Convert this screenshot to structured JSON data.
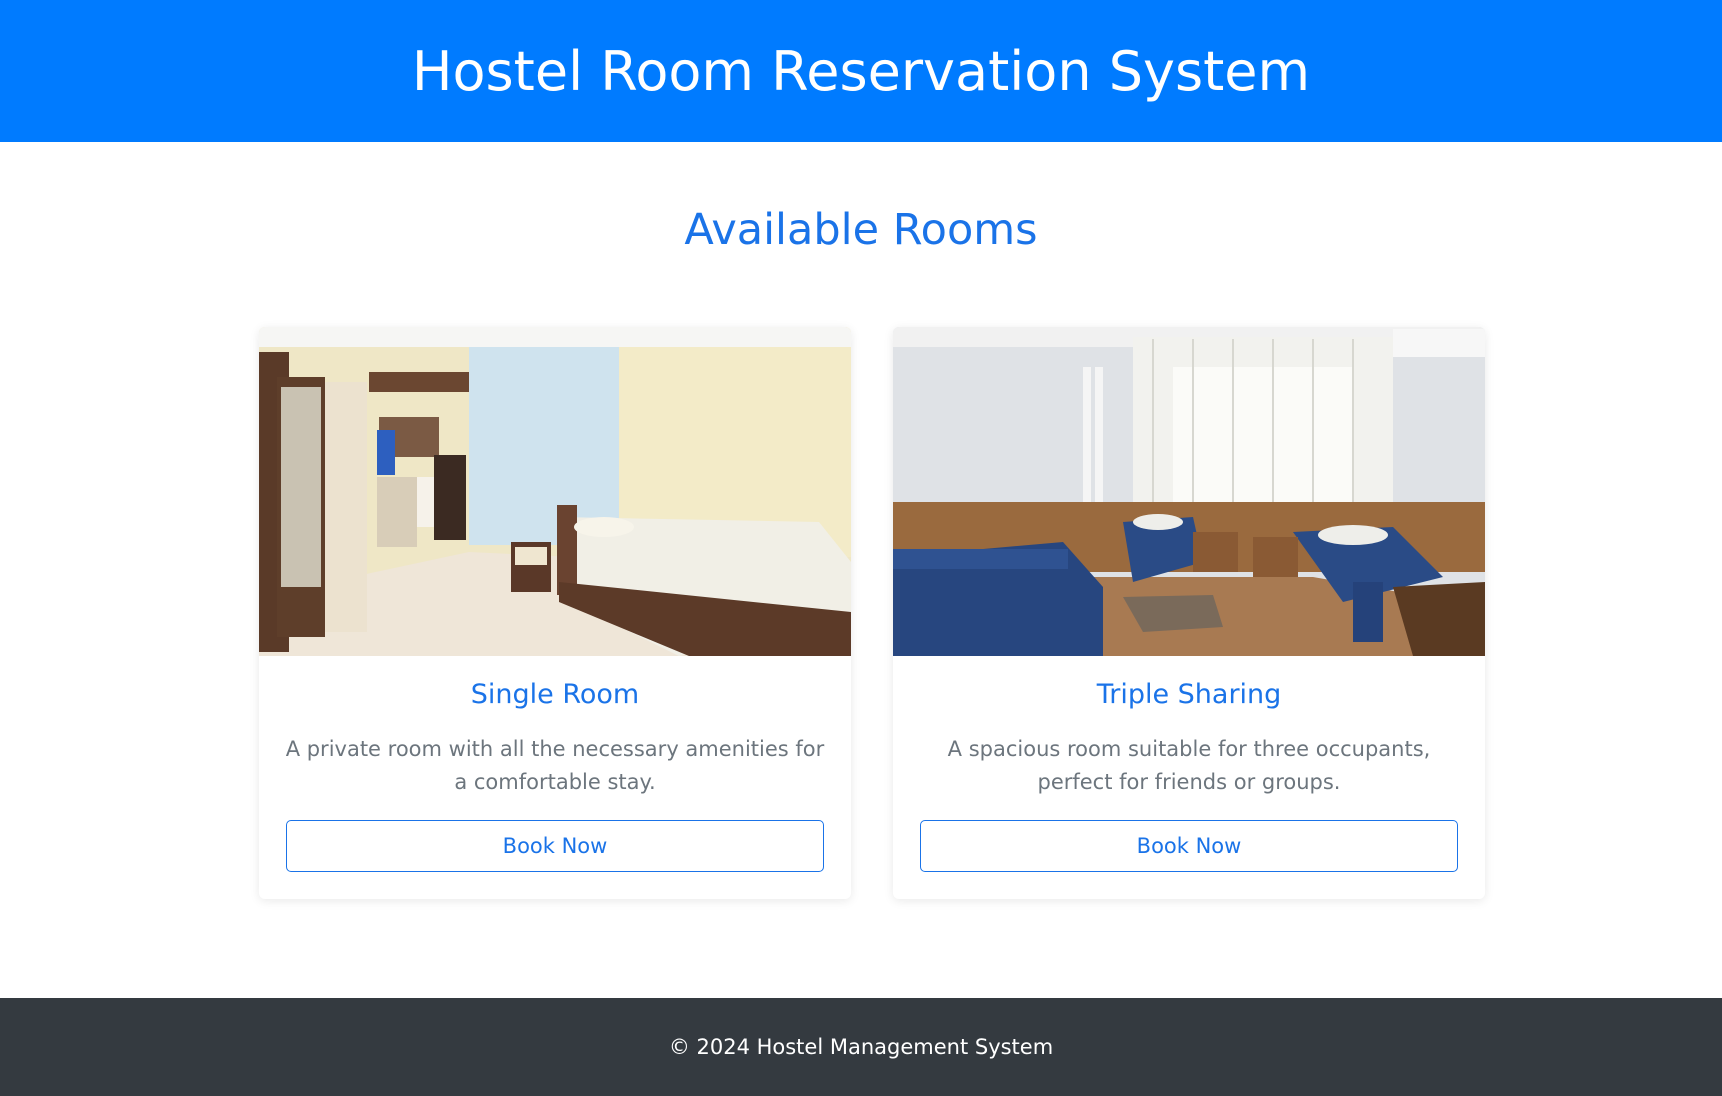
{
  "header": {
    "title": "Hostel Room Reservation System"
  },
  "main": {
    "section_title": "Available Rooms",
    "rooms": [
      {
        "name": "Single Room",
        "description": "A private room with all the necessary amenities for a comfortable stay.",
        "button_label": "Book Now"
      },
      {
        "name": "Triple Sharing",
        "description": "A spacious room suitable for three occupants, perfect for friends or groups.",
        "button_label": "Book Now"
      }
    ]
  },
  "footer": {
    "text": "© 2024 Hostel Management System"
  },
  "colors": {
    "header_bg": "#007bff",
    "accent": "#1a73e8",
    "footer_bg": "#343a40",
    "muted_text": "#6c757d"
  }
}
